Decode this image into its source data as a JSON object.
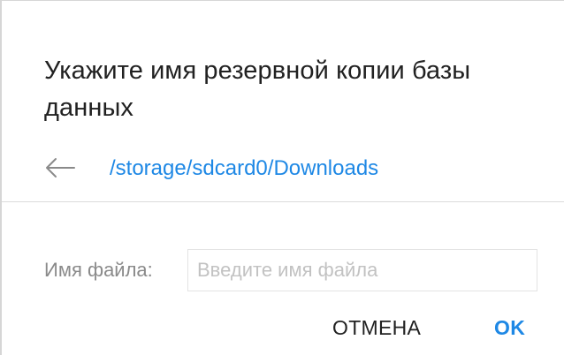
{
  "dialog": {
    "title": "Укажите имя резервной копии базы данных",
    "path": "/storage/sdcard0/Downloads",
    "back_icon": "arrow-left-icon",
    "filename": {
      "label": "Имя файла:",
      "value": "",
      "placeholder": "Введите имя файла"
    },
    "buttons": {
      "cancel_label": "ОТМЕНА",
      "ok_label": "OK"
    }
  },
  "colors": {
    "accent": "#1e88e5",
    "title_text": "#212121",
    "label_text": "#8a8a8a",
    "placeholder_text": "#c2c2c2",
    "divider": "#dcdcdc"
  }
}
